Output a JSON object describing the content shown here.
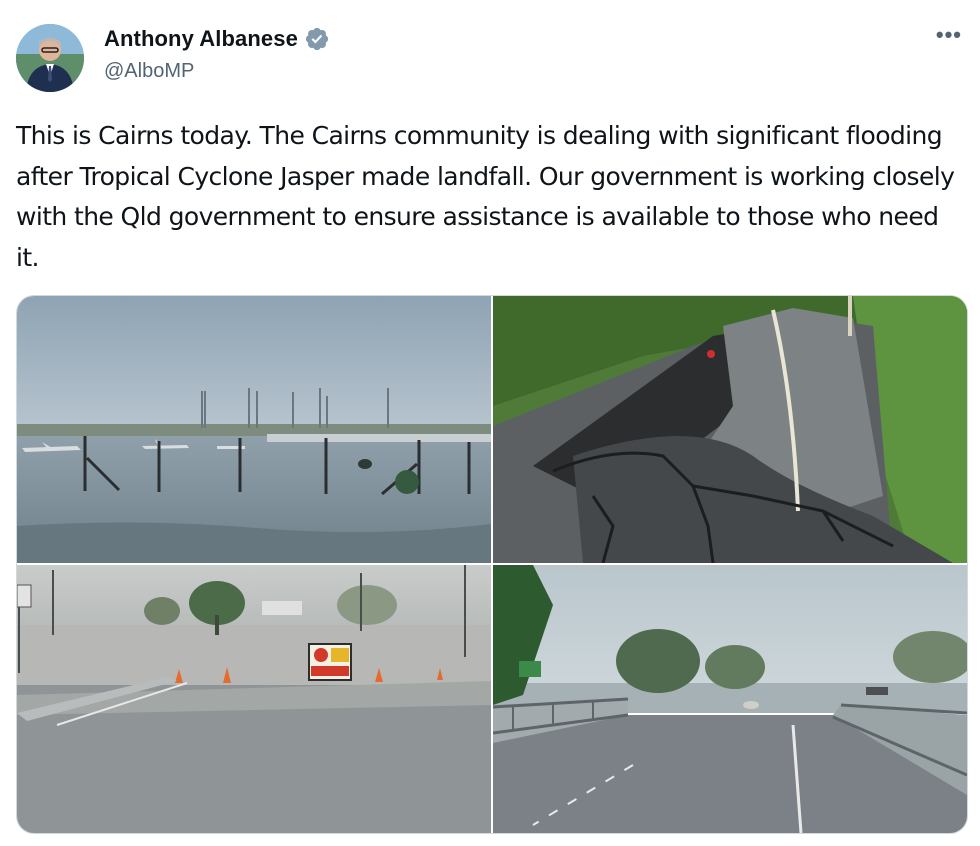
{
  "author": {
    "name": "Anthony Albanese",
    "handle": "@AlboMP",
    "verified_icon": "verified-badge-icon",
    "avatar_icon": "avatar"
  },
  "menu": {
    "more_label": "•••"
  },
  "tweet": {
    "text": "This is Cairns today. The Cairns community is dealing with significant flooding after Tropical Cyclone Jasper made landfall. Our government is working closely with the Qld government to ensure assistance is available to those who need it."
  },
  "media": {
    "photos": [
      {
        "subject": "flooded airport with fence and planes"
      },
      {
        "subject": "collapsed cracked road"
      },
      {
        "subject": "flooded road with warning sign and cones"
      },
      {
        "subject": "flooded bridge in rain"
      }
    ],
    "sign_text": [
      "ROAD",
      "CLOSED",
      "PREPARE TO STOP"
    ]
  },
  "colors": {
    "text": "#0f1419",
    "secondary": "#536471",
    "verified": "#829aab",
    "border": "#cfd9de"
  }
}
